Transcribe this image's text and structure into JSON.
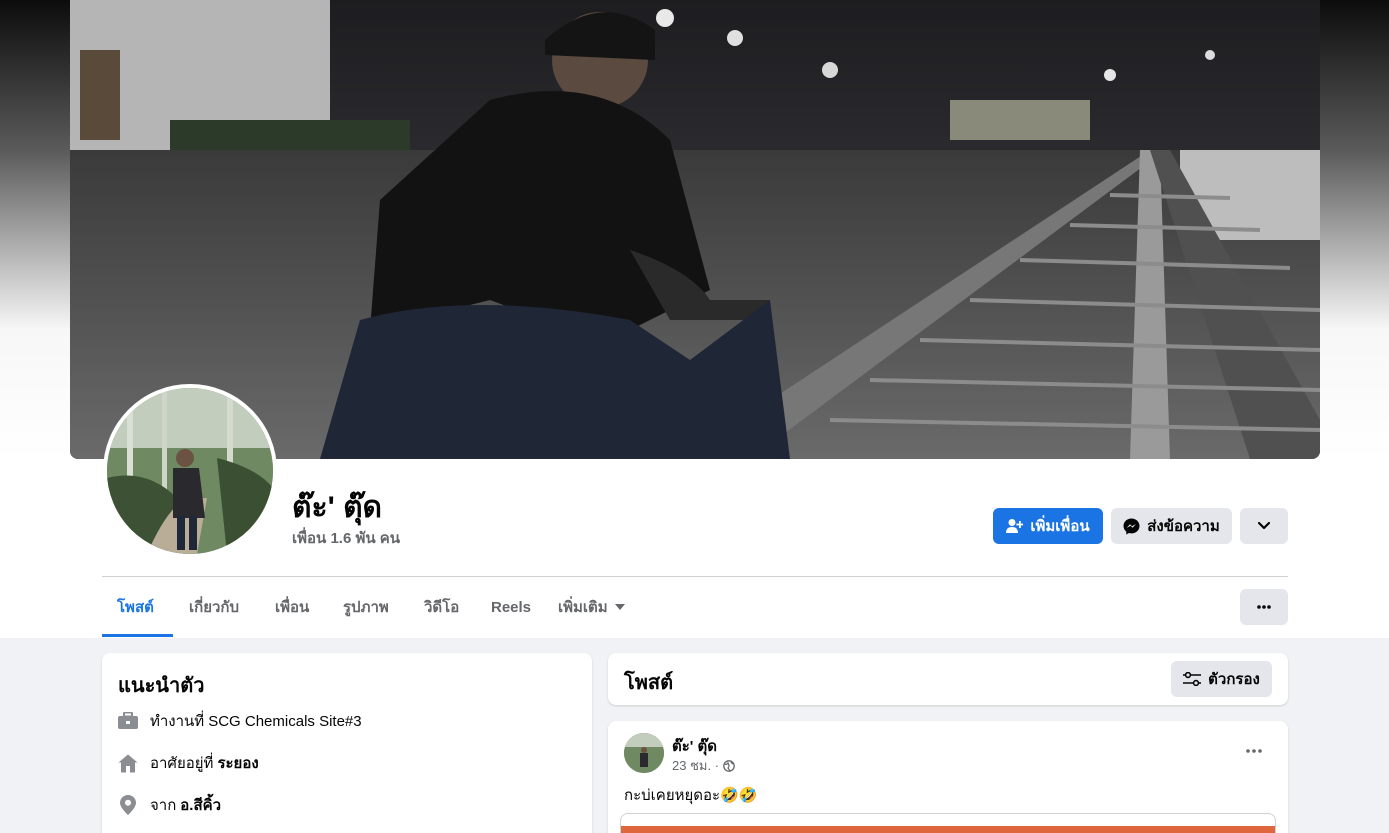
{
  "profile": {
    "name": "ต๊ะ' ตุ๊ด",
    "friends_count": "เพื่อน 1.6 พัน คน"
  },
  "actions": {
    "add_friend": "เพิ่มเพื่อน",
    "message": "ส่งข้อความ"
  },
  "tabs": [
    {
      "label": "โพสต์",
      "active": true
    },
    {
      "label": "เกี่ยวกับ",
      "active": false
    },
    {
      "label": "เพื่อน",
      "active": false
    },
    {
      "label": "รูปภาพ",
      "active": false
    },
    {
      "label": "วิดีโอ",
      "active": false
    },
    {
      "label": "Reels",
      "active": false
    },
    {
      "label": "เพิ่มเติม",
      "active": false
    }
  ],
  "intro": {
    "title": "แนะนำตัว",
    "work_prefix": "ทำงานที่",
    "work_value": "SCG Chemicals Site#3",
    "lives_prefix": "อาศัยอยู่ที่",
    "lives_value": "ระยอง",
    "from_prefix": "จาก",
    "from_value": "อ.สีคิ้ว"
  },
  "posts_header": {
    "title": "โพสต์",
    "filter_label": "ตัวกรอง"
  },
  "post": {
    "author": "ต๊ะ' ตุ๊ด",
    "time": "23 ชม. ·",
    "text": "กะบ่เคยหยุดอะ🤣🤣",
    "audience_icon": "globe-icon"
  },
  "colors": {
    "accent": "#1b74e4",
    "secondary_button": "#e4e6eb",
    "page_background": "#f0f2f5",
    "muted_text": "#65676b"
  }
}
